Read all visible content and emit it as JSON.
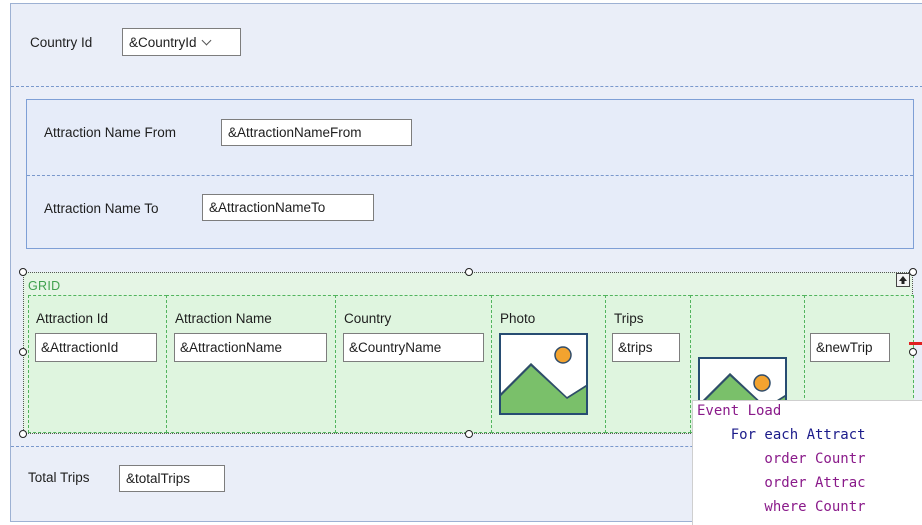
{
  "header": {
    "country_label": "Country Id",
    "country_value": "&CountryId"
  },
  "attraction_filters": {
    "from_label": "Attraction Name From",
    "from_value": "&AttractionNameFrom",
    "to_label": "Attraction Name To",
    "to_value": "&AttractionNameTo"
  },
  "grid": {
    "title": "GRID",
    "columns": [
      {
        "header": "Attraction Id",
        "field": "&AttractionId"
      },
      {
        "header": "Attraction Name",
        "field": "&AttractionName"
      },
      {
        "header": "Country",
        "field": "&CountryName"
      },
      {
        "header": "Photo",
        "field": ""
      },
      {
        "header": "Trips",
        "field": "&trips"
      },
      {
        "header": "",
        "field": ""
      },
      {
        "header": "",
        "field": "&newTrip"
      }
    ]
  },
  "footer": {
    "total_label": "Total Trips",
    "total_value": "&totalTrips"
  },
  "code": {
    "lines": [
      "Event Load",
      "    For each Attract",
      "        order Countr",
      "        order Attrac",
      "        where Countr"
    ]
  },
  "colors": {
    "panel_bg": "#eaeef8",
    "grid_bg": "#e5f5e5",
    "grid_label": "#3fa14e",
    "code_keyword": "#8a1a8a",
    "code_text": "#1b1b8a"
  },
  "icons": [
    "chevron-down-icon",
    "image-placeholder-icon",
    "move-up-icon",
    "resize-handle-icon"
  ]
}
